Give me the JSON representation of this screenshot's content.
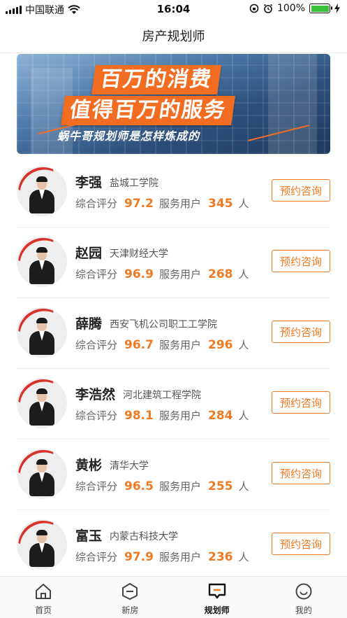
{
  "status_bar": {
    "carrier": "中国联通",
    "time": "16:04",
    "battery": "100%"
  },
  "nav": {
    "title": "房产规划师"
  },
  "banner": {
    "line1": "百万的消费",
    "line2": "值得百万的服务",
    "sub": "蜗牛哥规划师是怎样炼成的"
  },
  "stats_labels": {
    "score": "综合评分",
    "users": "服务用户",
    "unit": "人"
  },
  "book_label": "预约咨询",
  "planners": [
    {
      "name": "李强",
      "school": "盐城工学院",
      "score": "97.2",
      "users": "345"
    },
    {
      "name": "赵园",
      "school": "天津财经大学",
      "score": "96.9",
      "users": "268"
    },
    {
      "name": "薛腾",
      "school": "西安飞机公司职工工学院",
      "score": "96.7",
      "users": "296"
    },
    {
      "name": "李浩然",
      "school": "河北建筑工程学院",
      "score": "98.1",
      "users": "284"
    },
    {
      "name": "黄彬",
      "school": "清华大学",
      "score": "96.5",
      "users": "255"
    },
    {
      "name": "富玉",
      "school": "内蒙古科技大学",
      "score": "97.9",
      "users": "236"
    }
  ],
  "tabs": [
    {
      "label": "首页",
      "icon": "home-icon"
    },
    {
      "label": "新房",
      "icon": "new-house-icon"
    },
    {
      "label": "规划师",
      "icon": "planner-icon",
      "active": true
    },
    {
      "label": "我的",
      "icon": "profile-icon"
    }
  ],
  "colors": {
    "accent": "#f07a22",
    "banner_orange": "#f26d21"
  }
}
